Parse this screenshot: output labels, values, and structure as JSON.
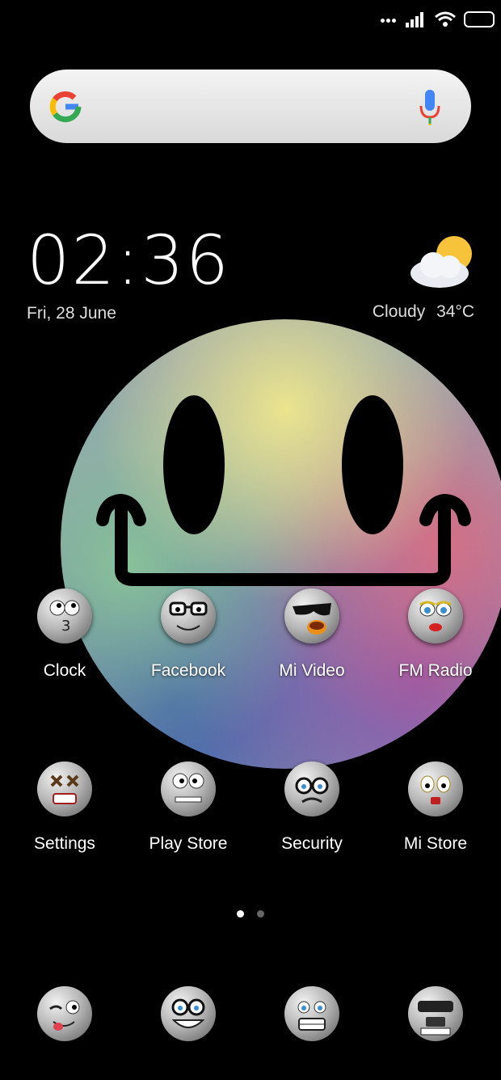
{
  "status_bar": {
    "icons": [
      "more-dots-icon",
      "signal-icon",
      "wifi-icon",
      "battery-icon"
    ]
  },
  "search": {
    "icons": [
      "google-icon",
      "mic-icon"
    ]
  },
  "clock_widget": {
    "time": "02:36",
    "date": "Fri, 28 June"
  },
  "weather": {
    "condition": "Cloudy",
    "temperature": "34°C",
    "icon": "partly-cloudy-icon"
  },
  "apps_row1": [
    {
      "label": "Clock"
    },
    {
      "label": "Facebook"
    },
    {
      "label": "Mi Video"
    },
    {
      "label": "FM Radio"
    }
  ],
  "apps_row2": [
    {
      "label": "Settings"
    },
    {
      "label": "Play Store"
    },
    {
      "label": "Security"
    },
    {
      "label": "Mi Store"
    }
  ],
  "pager": {
    "pages": 2,
    "current": 1
  },
  "dock": {
    "icons": [
      "wink-emoji-icon",
      "glasses-grin-emoji-icon",
      "grimace-emoji-icon",
      "masked-emoji-icon"
    ]
  }
}
